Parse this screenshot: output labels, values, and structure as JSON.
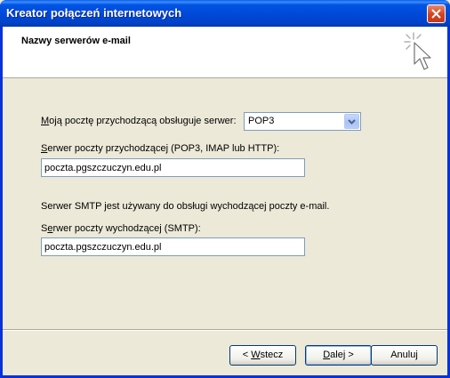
{
  "window": {
    "title": "Kreator połączeń internetowych"
  },
  "header": {
    "heading": "Nazwy serwerów e-mail",
    "icon": "wizard-sparkle-cursor-icon"
  },
  "form": {
    "incoming_type_label_mnemonic": "M",
    "incoming_type_label_rest": "oją pocztę przychodzącą obsługuje serwer:",
    "incoming_type_value": "POP3",
    "incoming_server_label_mnemonic": "S",
    "incoming_server_label_rest": "erwer poczty przychodzącej (POP3, IMAP lub HTTP):",
    "incoming_server_value": "poczta.pgszczuczyn.edu.pl",
    "smtp_info": "Serwer SMTP jest używany do obsługi wychodzącej poczty e-mail.",
    "outgoing_server_label_pre": "S",
    "outgoing_server_label_mnemonic": "e",
    "outgoing_server_label_rest": "rwer poczty wychodzącej (SMTP):",
    "outgoing_server_value": "poczta.pgszczuczyn.edu.pl"
  },
  "buttons": {
    "back_prefix": "< ",
    "back_mnemonic": "W",
    "back_rest": "stecz",
    "next_mnemonic": "D",
    "next_rest": "alej >",
    "cancel": "Anuluj"
  }
}
